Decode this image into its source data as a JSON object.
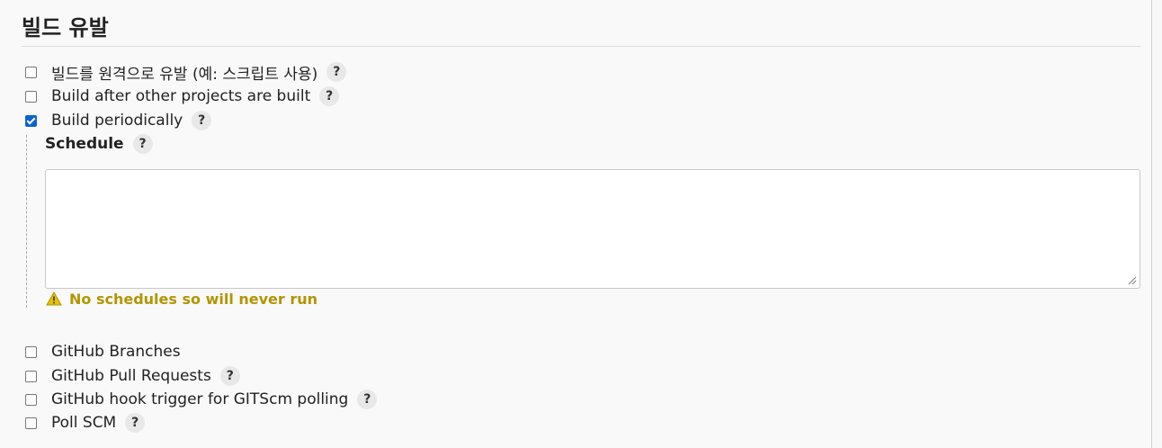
{
  "section": {
    "title": "빌드 유발"
  },
  "triggers": [
    {
      "label": "빌드를 원격으로 유발 (예: 스크립트 사용)",
      "checked": false,
      "help": "?"
    },
    {
      "label": "Build after other projects are built",
      "checked": false,
      "help": "?"
    },
    {
      "label": "Build periodically",
      "checked": true,
      "help": "?"
    }
  ],
  "schedule": {
    "label": "Schedule",
    "help": "?",
    "value": "",
    "warning": "No schedules so will never run",
    "warning_color": "#b39500"
  },
  "more_triggers": [
    {
      "label": "GitHub Branches",
      "checked": false
    },
    {
      "label": "GitHub Pull Requests",
      "checked": false,
      "help": "?"
    },
    {
      "label": "GitHub hook trigger for GITScm polling",
      "checked": false,
      "help": "?"
    },
    {
      "label": "Poll SCM",
      "checked": false,
      "help": "?"
    }
  ],
  "colors": {
    "accent": "#0b63d1",
    "help_bg": "#e8e8e8"
  }
}
